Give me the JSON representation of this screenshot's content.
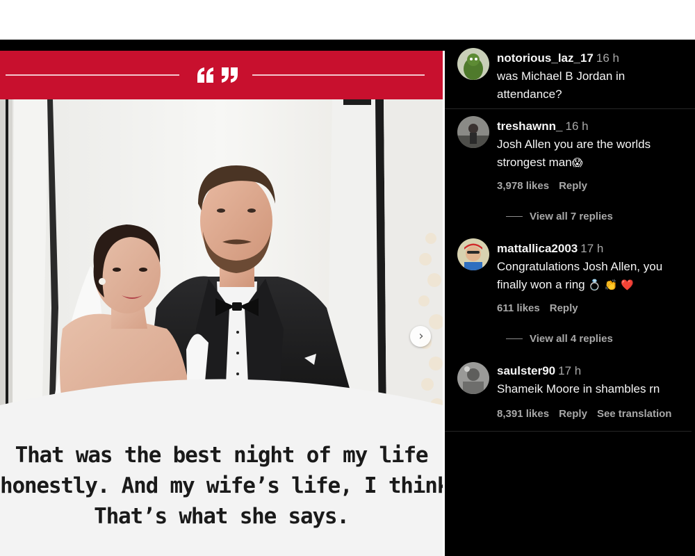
{
  "post": {
    "quote_lines": [
      "That was the best night of my life",
      "honestly. And my wife’s life, I think.",
      "That’s what she says."
    ],
    "banner_color": "#c8102e",
    "quote_icon": "quote-marks-icon",
    "next_icon": "chevron-right-icon"
  },
  "comments": [
    {
      "username": "notorious_laz_17",
      "time": "16 h",
      "text_lines": [
        "was Michael B Jordan in",
        "attendance?"
      ]
    },
    {
      "username": "treshawnn_",
      "time": "16 h",
      "text_lines": [
        "Josh Allen you are the worlds",
        "strongest man"
      ],
      "emoji": "😱",
      "likes": "3,978 likes",
      "reply_label": "Reply",
      "view_replies": "View all 7 replies"
    },
    {
      "username": "mattallica2003",
      "time": "17 h",
      "text_lines": [
        "Congratulations Josh Allen, you",
        "finally won a ring"
      ],
      "emoji": "💍 👏 ❤️",
      "likes": "611 likes",
      "reply_label": "Reply",
      "view_replies": "View all 4 replies"
    },
    {
      "username": "saulster90",
      "time": "17 h",
      "text_lines": [
        "Shameik Moore in shambles rn"
      ],
      "likes": "8,391 likes",
      "reply_label": "Reply",
      "translation_label": "See translation"
    }
  ]
}
